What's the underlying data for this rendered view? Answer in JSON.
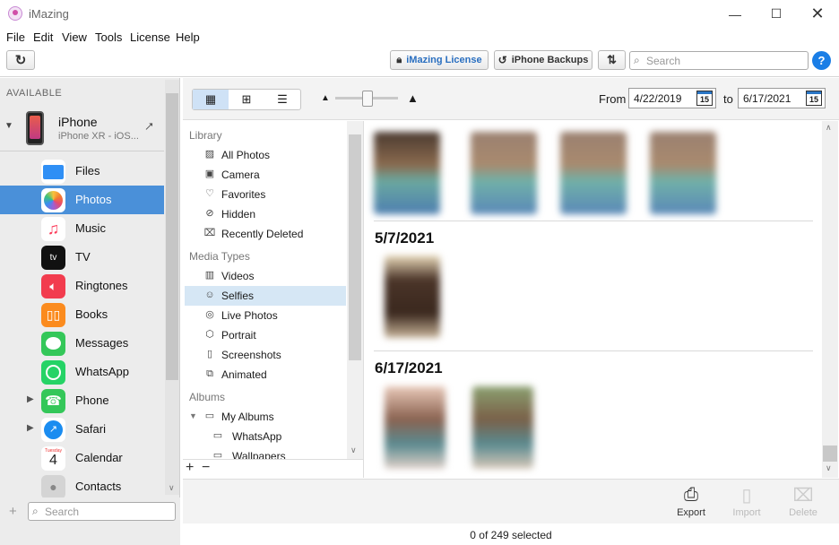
{
  "app": {
    "title": "iMazing"
  },
  "menu": [
    "File",
    "Edit",
    "View",
    "Tools",
    "License",
    "Help"
  ],
  "toolbar": {
    "license_btn": "iMazing License",
    "backups_btn": "iPhone Backups",
    "search_placeholder": "Search"
  },
  "sidebar": {
    "section_title": "AVAILABLE",
    "device": {
      "name": "iPhone",
      "subtitle": "iPhone XR - iOS..."
    },
    "items": [
      {
        "label": "Files",
        "color": "#2f8ff5"
      },
      {
        "label": "Photos",
        "color": "#ffffff",
        "selected": true
      },
      {
        "label": "Music",
        "color": "#fc3c5a"
      },
      {
        "label": "TV",
        "color": "#111111",
        "glyph": "tv"
      },
      {
        "label": "Ringtones",
        "color": "#f23c4e"
      },
      {
        "label": "Books",
        "color": "#fb8b1e"
      },
      {
        "label": "Messages",
        "color": "#34c759"
      },
      {
        "label": "WhatsApp",
        "color": "#25d366"
      },
      {
        "label": "Phone",
        "color": "#34c759",
        "expandable": true
      },
      {
        "label": "Safari",
        "color": "#1a8cf0",
        "expandable": true
      },
      {
        "label": "Calendar",
        "color": "#ffffff",
        "cal_day": "Tuesday",
        "cal_num": "4"
      },
      {
        "label": "Contacts",
        "color": "#b6b6b6"
      }
    ],
    "search_placeholder": "Search"
  },
  "view": {
    "from_label": "From",
    "from_date": "4/22/2019",
    "to_label": "to",
    "to_date": "6/17/2021",
    "cal_num": "15"
  },
  "library": {
    "sections": [
      {
        "title": "Library",
        "items": [
          "All Photos",
          "Camera",
          "Favorites",
          "Hidden",
          "Recently Deleted"
        ]
      },
      {
        "title": "Media Types",
        "items": [
          "Videos",
          "Selfies",
          "Live Photos",
          "Portrait",
          "Screenshots",
          "Animated"
        ]
      },
      {
        "title": "Albums",
        "items": [
          "My Albums",
          "WhatsApp",
          "Wallpapers"
        ]
      }
    ],
    "selected": "Selfies"
  },
  "photos": {
    "groups": [
      {
        "date": "5/7/2021"
      },
      {
        "date": "6/17/2021"
      }
    ]
  },
  "actions": {
    "export": "Export",
    "import": "Import",
    "delete": "Delete"
  },
  "status": "0 of 249 selected"
}
